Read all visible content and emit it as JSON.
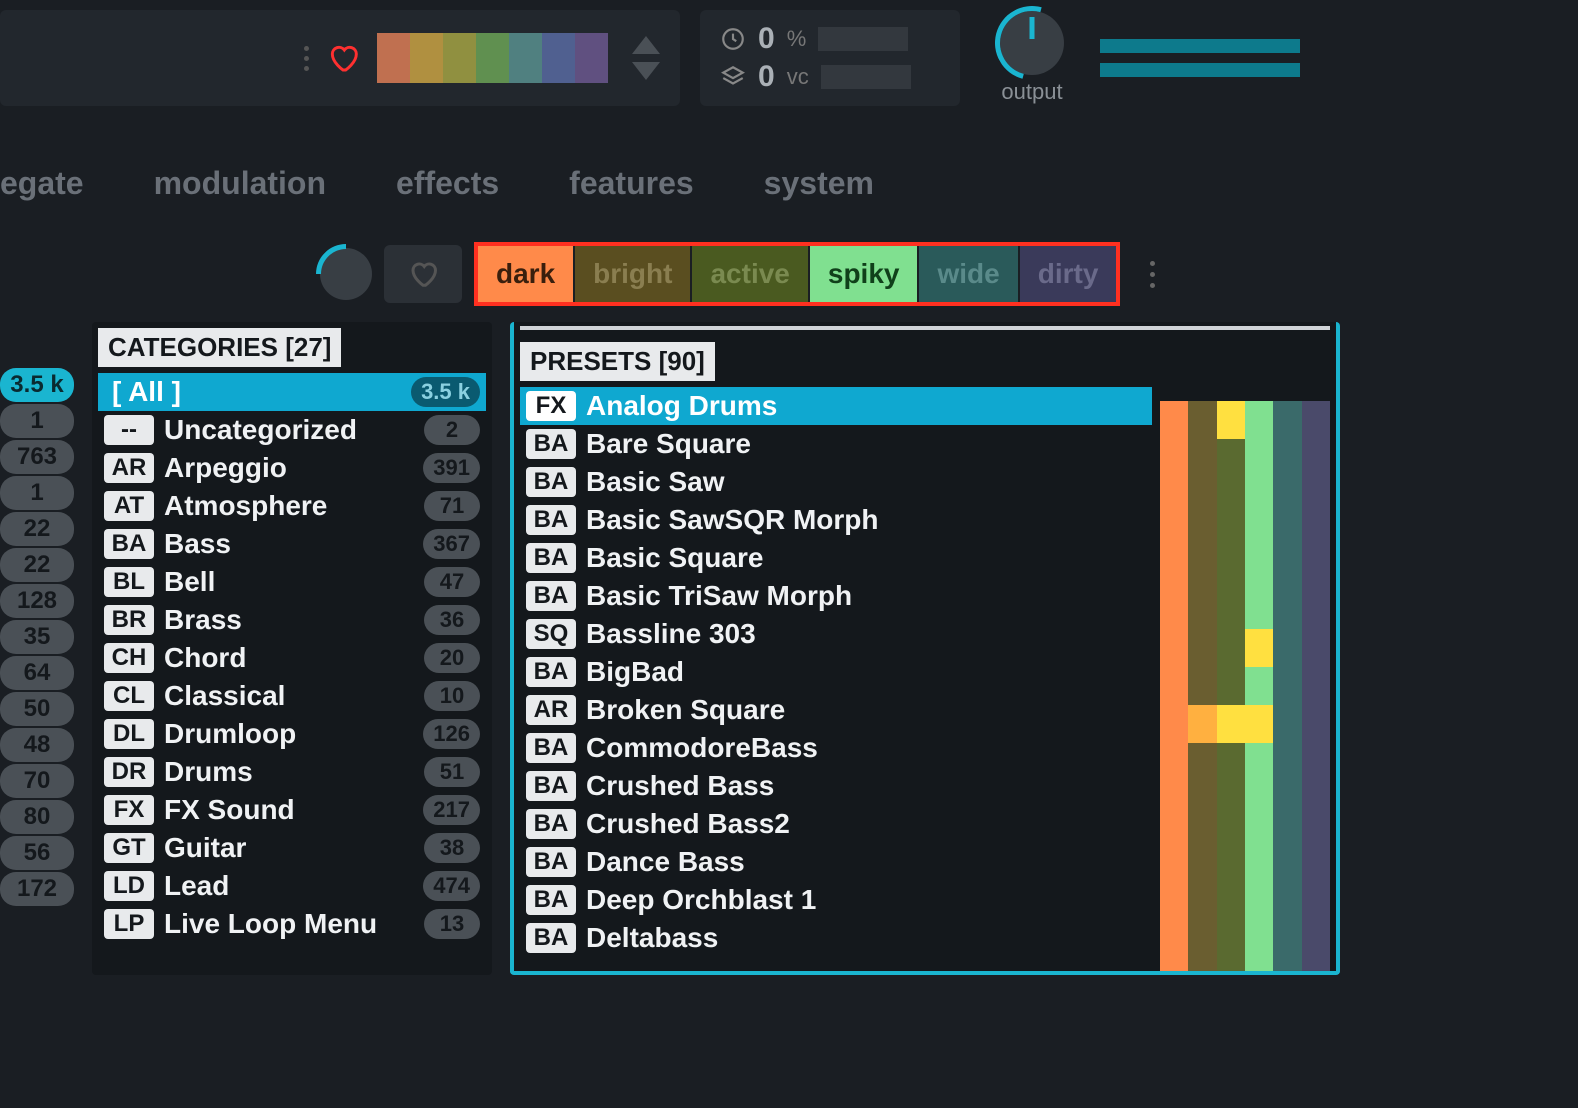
{
  "topbar": {
    "colors": [
      "#c07050",
      "#b09040",
      "#909040",
      "#609050",
      "#508080",
      "#506090",
      "#605080"
    ],
    "cpu_pct": "0",
    "cpu_unit": "%",
    "voices": "0",
    "voices_unit": "vc",
    "output_label": "output"
  },
  "nav": [
    "egate",
    "modulation",
    "effects",
    "features",
    "system"
  ],
  "tags": [
    {
      "label": "dark",
      "cls": "dark"
    },
    {
      "label": "bright",
      "cls": "bright"
    },
    {
      "label": "active",
      "cls": "active"
    },
    {
      "label": "spiky",
      "cls": "spiky"
    },
    {
      "label": "wide",
      "cls": "wide"
    },
    {
      "label": "dirty",
      "cls": "dirty"
    }
  ],
  "side_counts": [
    "3.5 k",
    "1",
    "763",
    "1",
    "22",
    "22",
    "128",
    "35",
    "64",
    "50",
    "48",
    "70",
    "80",
    "56",
    "172"
  ],
  "categories_header": "CATEGORIES [27]",
  "categories": [
    {
      "tag": "",
      "name": "[ All ]",
      "count": "3.5 k",
      "sel": true,
      "all": true
    },
    {
      "tag": "--",
      "name": "Uncategorized",
      "count": "2"
    },
    {
      "tag": "AR",
      "name": "Arpeggio",
      "count": "391"
    },
    {
      "tag": "AT",
      "name": "Atmosphere",
      "count": "71"
    },
    {
      "tag": "BA",
      "name": "Bass",
      "count": "367"
    },
    {
      "tag": "BL",
      "name": "Bell",
      "count": "47"
    },
    {
      "tag": "BR",
      "name": "Brass",
      "count": "36"
    },
    {
      "tag": "CH",
      "name": "Chord",
      "count": "20"
    },
    {
      "tag": "CL",
      "name": "Classical",
      "count": "10"
    },
    {
      "tag": "DL",
      "name": "Drumloop",
      "count": "126"
    },
    {
      "tag": "DR",
      "name": "Drums",
      "count": "51"
    },
    {
      "tag": "FX",
      "name": "FX Sound",
      "count": "217"
    },
    {
      "tag": "GT",
      "name": "Guitar",
      "count": "38"
    },
    {
      "tag": "LD",
      "name": "Lead",
      "count": "474"
    },
    {
      "tag": "LP",
      "name": "Live Loop Menu",
      "count": "13"
    }
  ],
  "presets_header": "PRESETS [90]",
  "presets": [
    {
      "tag": "FX",
      "name": "Analog Drums",
      "sel": true
    },
    {
      "tag": "BA",
      "name": "Bare Square"
    },
    {
      "tag": "BA",
      "name": "Basic Saw"
    },
    {
      "tag": "BA",
      "name": "Basic SawSQR Morph"
    },
    {
      "tag": "BA",
      "name": "Basic Square"
    },
    {
      "tag": "BA",
      "name": "Basic TriSaw Morph"
    },
    {
      "tag": "SQ",
      "name": "Bassline 303"
    },
    {
      "tag": "BA",
      "name": "BigBad"
    },
    {
      "tag": "AR",
      "name": "Broken Square"
    },
    {
      "tag": "BA",
      "name": "CommodoreBass"
    },
    {
      "tag": "BA",
      "name": "Crushed Bass"
    },
    {
      "tag": "BA",
      "name": "Crushed Bass2"
    },
    {
      "tag": "BA",
      "name": "Dance Bass"
    },
    {
      "tag": "BA",
      "name": "Deep Orchblast 1"
    },
    {
      "tag": "BA",
      "name": "Deltabass"
    }
  ],
  "viz_palette": [
    "#ff8a4a",
    "#6a5e30",
    "#5a6a30",
    "#80e090",
    "#3a6a6a",
    "#4a4a6a"
  ],
  "viz_rows": [
    [
      0,
      1,
      4,
      3,
      4,
      5
    ],
    [
      0,
      1,
      2,
      3,
      4,
      5
    ],
    [
      0,
      1,
      2,
      3,
      4,
      5
    ],
    [
      0,
      1,
      2,
      3,
      4,
      5
    ],
    [
      0,
      1,
      2,
      3,
      4,
      5
    ],
    [
      0,
      1,
      2,
      3,
      4,
      5
    ],
    [
      0,
      1,
      2,
      4,
      4,
      5
    ],
    [
      0,
      1,
      2,
      3,
      4,
      5
    ],
    [
      0,
      4,
      4,
      3,
      4,
      5
    ],
    [
      0,
      1,
      2,
      3,
      4,
      5
    ],
    [
      0,
      1,
      2,
      3,
      4,
      5
    ],
    [
      0,
      1,
      2,
      3,
      4,
      5
    ],
    [
      0,
      1,
      2,
      3,
      4,
      5
    ],
    [
      0,
      1,
      2,
      3,
      4,
      5
    ],
    [
      0,
      1,
      2,
      3,
      4,
      5
    ]
  ],
  "viz_overrides": {
    "0": {
      "2": "#ffe040"
    },
    "6": {
      "3": "#ffe040"
    },
    "8": {
      "1": "#ffb040",
      "2": "#ffe040",
      "3": "#ffe040"
    }
  }
}
